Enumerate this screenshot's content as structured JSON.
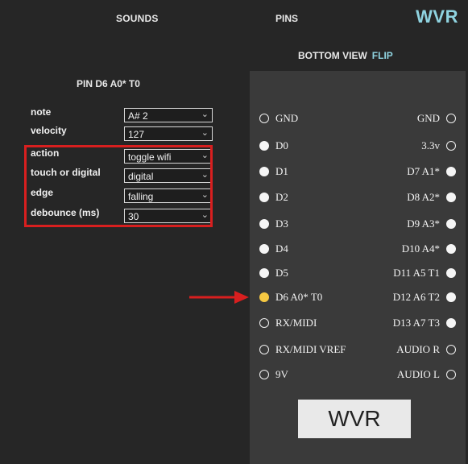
{
  "header": {
    "sounds_tab": "SOUNDS",
    "pins_tab": "PINS",
    "logo": "WVR"
  },
  "view": {
    "label": "BOTTOM VIEW",
    "flip": "FLIP"
  },
  "settings": {
    "title": "PIN D6 A0* T0",
    "rows": [
      {
        "label": "note",
        "value": "A# 2"
      },
      {
        "label": "velocity",
        "value": "127"
      },
      {
        "label": "action",
        "value": "toggle wifi"
      },
      {
        "label": "touch or digital",
        "value": "digital"
      },
      {
        "label": "edge",
        "value": "falling"
      },
      {
        "label": "debounce (ms)",
        "value": "30"
      }
    ]
  },
  "board": {
    "left_pins": [
      {
        "label": "GND",
        "state": "empty"
      },
      {
        "label": "D0",
        "state": "filled"
      },
      {
        "label": "D1",
        "state": "filled"
      },
      {
        "label": "D2",
        "state": "filled"
      },
      {
        "label": "D3",
        "state": "filled"
      },
      {
        "label": "D4",
        "state": "filled"
      },
      {
        "label": "D5",
        "state": "filled"
      },
      {
        "label": "D6 A0* T0",
        "state": "active"
      },
      {
        "label": "RX/MIDI",
        "state": "empty"
      },
      {
        "label": "RX/MIDI VREF",
        "state": "empty"
      },
      {
        "label": "9V",
        "state": "empty"
      }
    ],
    "right_pins": [
      {
        "label": "GND",
        "state": "empty"
      },
      {
        "label": "3.3v",
        "state": "empty"
      },
      {
        "label": "D7 A1*",
        "state": "filled"
      },
      {
        "label": "D8 A2*",
        "state": "filled"
      },
      {
        "label": "D9 A3*",
        "state": "filled"
      },
      {
        "label": "D10 A4*",
        "state": "filled"
      },
      {
        "label": "D11 A5 T1",
        "state": "filled"
      },
      {
        "label": "D12 A6 T2",
        "state": "filled"
      },
      {
        "label": "D13 A7 T3",
        "state": "filled"
      },
      {
        "label": "AUDIO R",
        "state": "empty"
      },
      {
        "label": "AUDIO L",
        "state": "empty"
      }
    ],
    "button": "WVR"
  },
  "colors": {
    "accent": "#8fd3e0",
    "highlight_box": "#d81f1f",
    "arrow": "#d81f1f",
    "active_pin": "#f5c842",
    "background": "#262626",
    "board": "#3a3a3a"
  }
}
